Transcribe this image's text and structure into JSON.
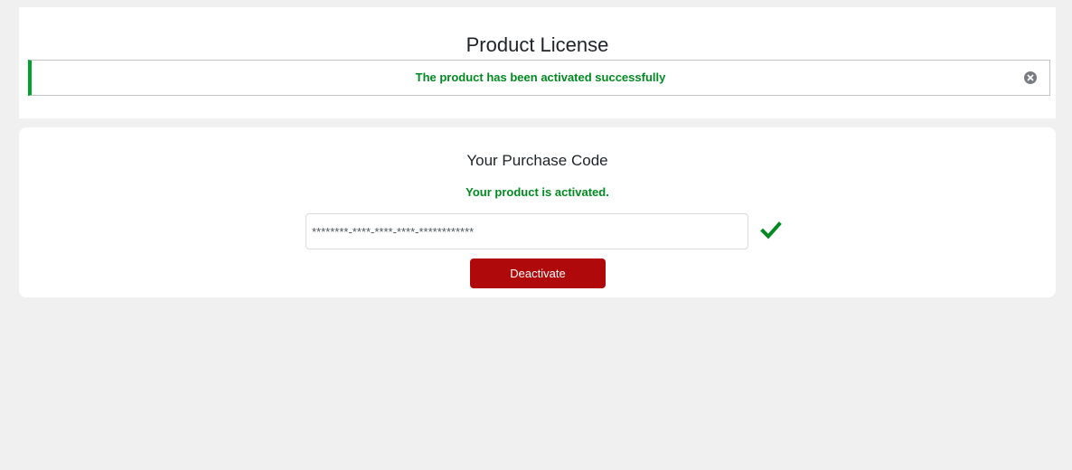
{
  "header": {
    "title": "Product License"
  },
  "notice": {
    "message": "The product has been activated successfully",
    "dismiss_icon": "close-circle-icon"
  },
  "license": {
    "title": "Your Purchase Code",
    "status": "Your product is activated.",
    "code_value": "********-****-****-****-************",
    "check_icon": "checkmark-icon",
    "deactivate_label": "Deactivate"
  },
  "colors": {
    "success": "#008a20",
    "notice_border": "#00a32a",
    "danger": "#b0090b"
  }
}
